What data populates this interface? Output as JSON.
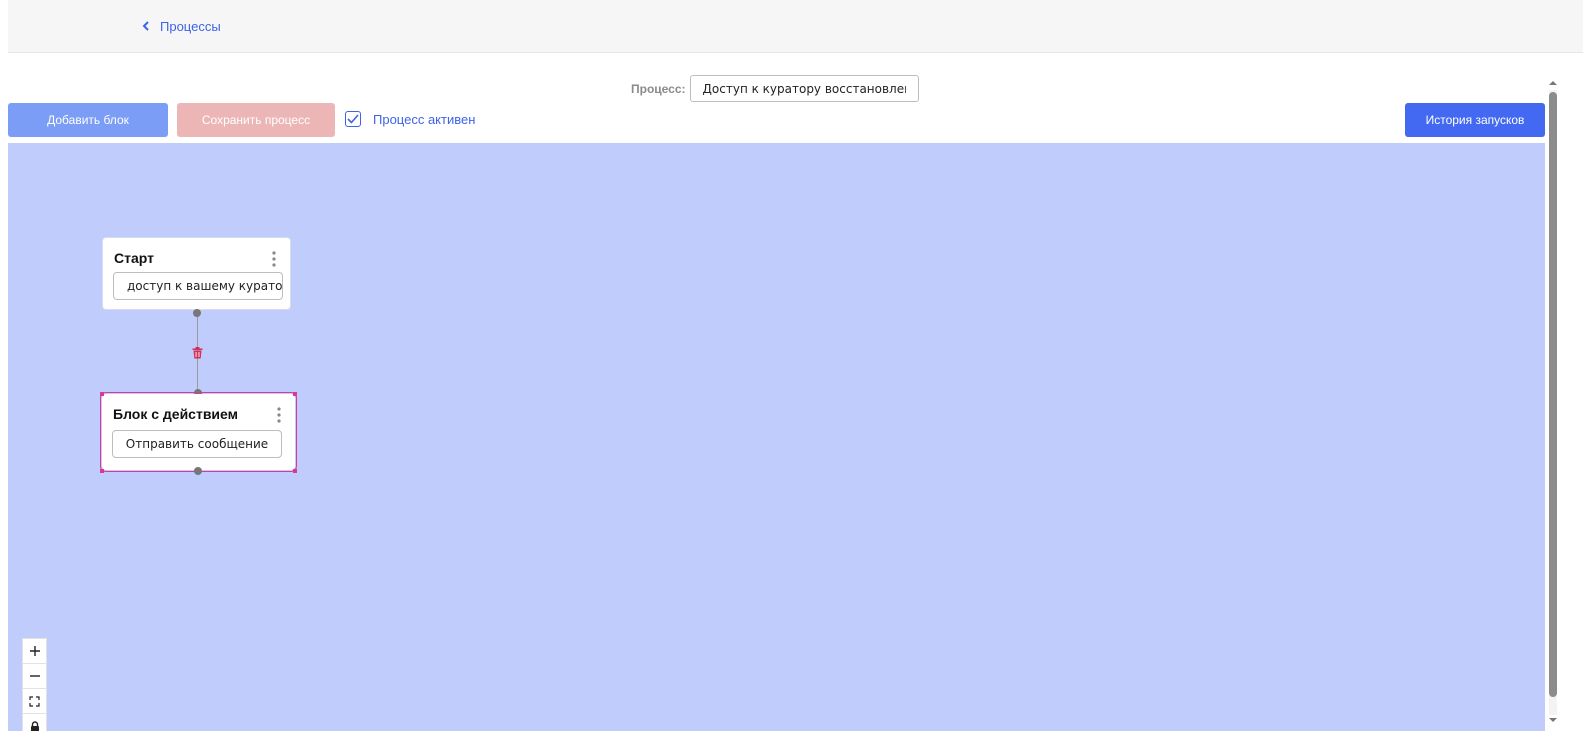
{
  "header": {
    "back_label": "Процессы"
  },
  "process": {
    "label": "Процесс:",
    "name": "Доступ к куратору восстановлен"
  },
  "toolbar": {
    "add_block": "Добавить блок",
    "save_process": "Сохранить процесс",
    "active_label": "Процесс активен",
    "active_checked": true,
    "history": "История запусков"
  },
  "nodes": [
    {
      "title": "Старт",
      "field": "доступ к вашему куратору"
    },
    {
      "title": "Блок с действием",
      "field": "Отправить сообщение"
    }
  ],
  "controls": [
    "plus-icon",
    "minus-icon",
    "fit-view-icon",
    "lock-icon"
  ],
  "colors": {
    "accent": "#4368f1",
    "canvas": "#bfccfc",
    "save_disabled": "#edb6b6",
    "selection": "#d83a93"
  }
}
